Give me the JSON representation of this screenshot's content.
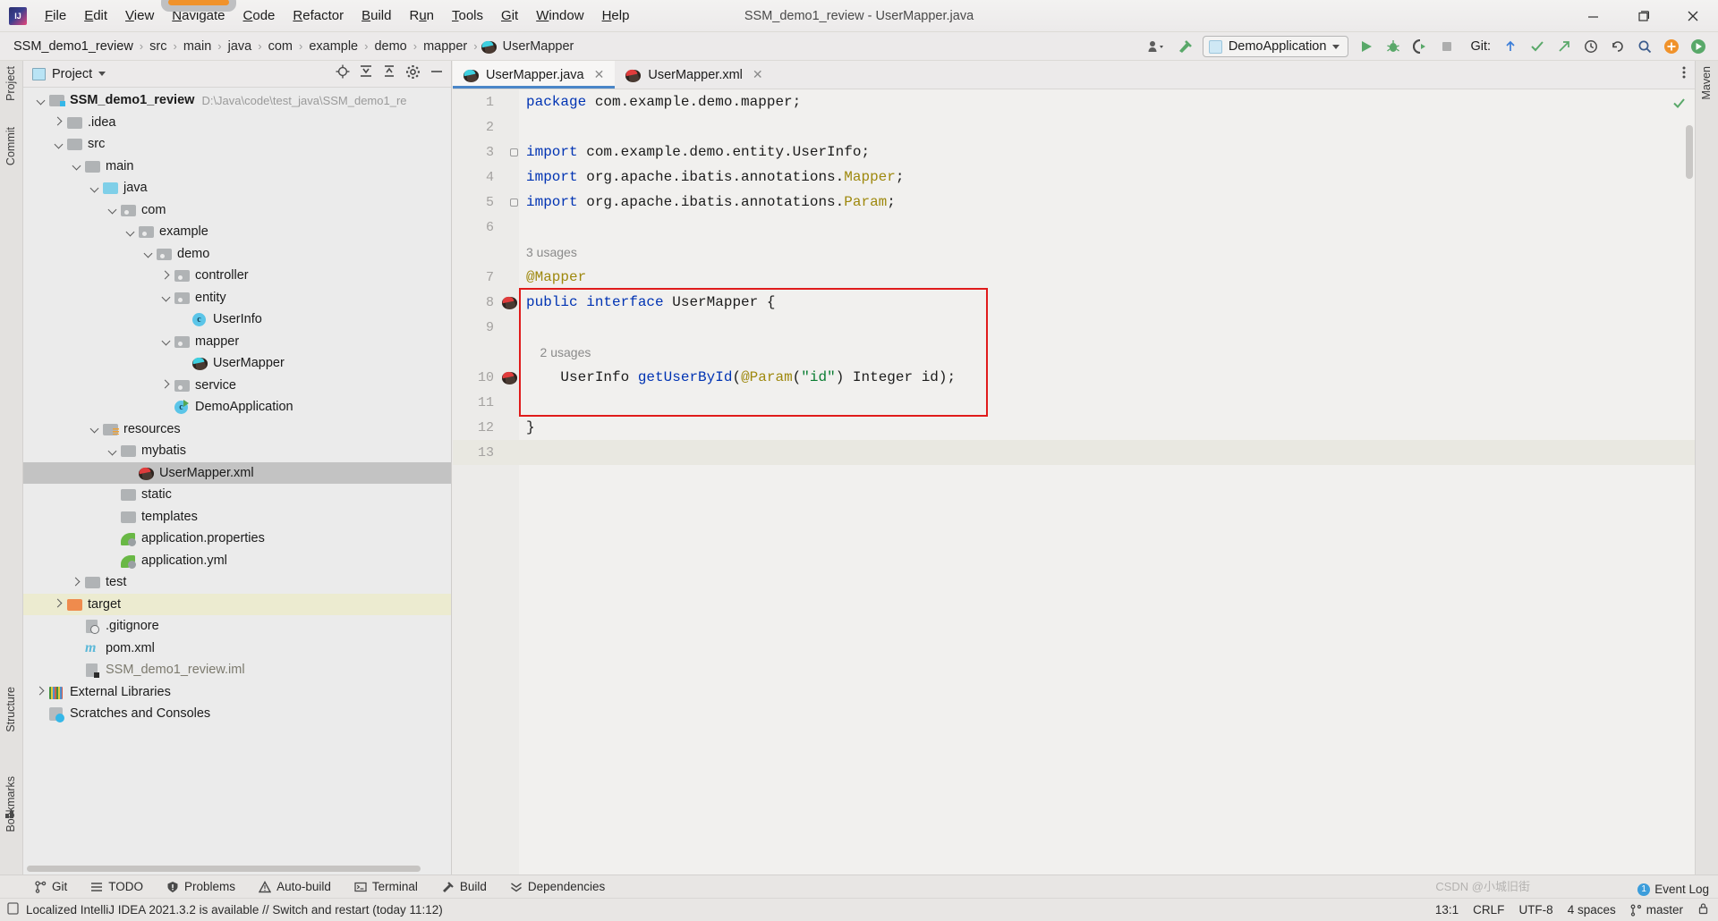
{
  "window": {
    "title": "SSM_demo1_review - UserMapper.java",
    "minimize": "—",
    "maximize": "▢",
    "close": "✕"
  },
  "menu": {
    "items": [
      {
        "label": "File",
        "mnemonic": "F"
      },
      {
        "label": "Edit",
        "mnemonic": "E"
      },
      {
        "label": "View",
        "mnemonic": "V"
      },
      {
        "label": "Navigate",
        "mnemonic": "N"
      },
      {
        "label": "Code",
        "mnemonic": "C"
      },
      {
        "label": "Refactor",
        "mnemonic": "R"
      },
      {
        "label": "Build",
        "mnemonic": "B"
      },
      {
        "label": "Run",
        "mnemonic": "u"
      },
      {
        "label": "Tools",
        "mnemonic": "T"
      },
      {
        "label": "Git",
        "mnemonic": "G"
      },
      {
        "label": "Window",
        "mnemonic": "W"
      },
      {
        "label": "Help",
        "mnemonic": "H"
      }
    ]
  },
  "breadcrumb": {
    "items": [
      "SSM_demo1_review",
      "src",
      "main",
      "java",
      "com",
      "example",
      "demo",
      "mapper",
      "UserMapper"
    ],
    "separator": "›"
  },
  "toolbar": {
    "run_config": "DemoApplication",
    "git_label": "Git:",
    "icons": [
      "user-dropdown-icon",
      "build-hammer-icon",
      "run-icon",
      "debug-icon",
      "run-coverage-icon",
      "stop-icon",
      "git-update-icon",
      "git-commit-icon",
      "git-push-icon",
      "history-icon",
      "undo-icon",
      "search-icon",
      "settings-plus-icon",
      "ide-icon"
    ]
  },
  "left_stripe": [
    "Project",
    "Commit",
    "Structure",
    "Bookmarks"
  ],
  "right_stripe": [
    "Maven"
  ],
  "project": {
    "title": "Project",
    "actions": [
      "locate-icon",
      "expand-all-icon",
      "collapse-all-icon",
      "settings-icon",
      "hide-icon"
    ],
    "tree": [
      {
        "label": "SSM_demo1_review",
        "detail": "D:\\Java\\code\\test_java\\SSM_demo1_re",
        "indent": 0,
        "arrow": "down",
        "icon": "module-folder",
        "bold": true
      },
      {
        "label": ".idea",
        "detail": "",
        "indent": 1,
        "arrow": "right",
        "icon": "folder"
      },
      {
        "label": "src",
        "detail": "",
        "indent": 1,
        "arrow": "down",
        "icon": "folder"
      },
      {
        "label": "main",
        "detail": "",
        "indent": 2,
        "arrow": "down",
        "icon": "folder"
      },
      {
        "label": "java",
        "detail": "",
        "indent": 3,
        "arrow": "down",
        "icon": "source-folder"
      },
      {
        "label": "com",
        "detail": "",
        "indent": 4,
        "arrow": "down",
        "icon": "package"
      },
      {
        "label": "example",
        "detail": "",
        "indent": 5,
        "arrow": "down",
        "icon": "package"
      },
      {
        "label": "demo",
        "detail": "",
        "indent": 6,
        "arrow": "down",
        "icon": "package"
      },
      {
        "label": "controller",
        "detail": "",
        "indent": 7,
        "arrow": "right",
        "icon": "package"
      },
      {
        "label": "entity",
        "detail": "",
        "indent": 7,
        "arrow": "down",
        "icon": "package"
      },
      {
        "label": "UserInfo",
        "detail": "",
        "indent": 8,
        "arrow": "none",
        "icon": "class"
      },
      {
        "label": "mapper",
        "detail": "",
        "indent": 7,
        "arrow": "down",
        "icon": "package"
      },
      {
        "label": "UserMapper",
        "detail": "",
        "indent": 8,
        "arrow": "none",
        "icon": "mybatis"
      },
      {
        "label": "service",
        "detail": "",
        "indent": 7,
        "arrow": "right",
        "icon": "package"
      },
      {
        "label": "DemoApplication",
        "detail": "",
        "indent": 7,
        "arrow": "none",
        "icon": "class-run"
      },
      {
        "label": "resources",
        "detail": "",
        "indent": 3,
        "arrow": "down",
        "icon": "resource-folder"
      },
      {
        "label": "mybatis",
        "detail": "",
        "indent": 4,
        "arrow": "down",
        "icon": "folder"
      },
      {
        "label": "UserMapper.xml",
        "detail": "",
        "indent": 5,
        "arrow": "none",
        "icon": "mybatis-xml",
        "selected": true
      },
      {
        "label": "static",
        "detail": "",
        "indent": 4,
        "arrow": "none",
        "icon": "folder"
      },
      {
        "label": "templates",
        "detail": "",
        "indent": 4,
        "arrow": "none",
        "icon": "folder"
      },
      {
        "label": "application.properties",
        "detail": "",
        "indent": 4,
        "arrow": "none",
        "icon": "spring-leaf"
      },
      {
        "label": "application.yml",
        "detail": "",
        "indent": 4,
        "arrow": "none",
        "icon": "spring-leaf"
      },
      {
        "label": "test",
        "detail": "",
        "indent": 2,
        "arrow": "right",
        "icon": "folder"
      },
      {
        "label": "target",
        "detail": "",
        "indent": 1,
        "arrow": "right",
        "icon": "excluded-folder",
        "highlight": true
      },
      {
        "label": ".gitignore",
        "detail": "",
        "indent": 2,
        "arrow": "none",
        "icon": "gitignore-file"
      },
      {
        "label": "pom.xml",
        "detail": "",
        "indent": 2,
        "arrow": "none",
        "icon": "maven-file"
      },
      {
        "label": "SSM_demo1_review.iml",
        "detail": "",
        "indent": 2,
        "arrow": "none",
        "icon": "iml-file",
        "muted": true
      },
      {
        "label": "External Libraries",
        "detail": "",
        "indent": 0,
        "arrow": "right",
        "icon": "library"
      },
      {
        "label": "Scratches and Consoles",
        "detail": "",
        "indent": 0,
        "arrow": "none",
        "icon": "scratch"
      }
    ]
  },
  "editor": {
    "tabs": [
      {
        "label": "UserMapper.java",
        "icon": "mybatis-java-icon",
        "active": true,
        "close": "✕"
      },
      {
        "label": "UserMapper.xml",
        "icon": "mybatis-xml-icon",
        "active": false,
        "close": "✕"
      }
    ],
    "lines": [
      {
        "num": "1",
        "gutter": "",
        "segments": [
          {
            "t": "package",
            "c": "kw"
          },
          {
            "t": " com.example.demo.mapper;",
            "c": "typ"
          }
        ]
      },
      {
        "num": "2",
        "gutter": "",
        "segments": []
      },
      {
        "num": "3",
        "gutter": "",
        "fold": true,
        "segments": [
          {
            "t": "import",
            "c": "kw"
          },
          {
            "t": " com.example.demo.entity.UserInfo;",
            "c": "typ"
          }
        ]
      },
      {
        "num": "4",
        "gutter": "",
        "segments": [
          {
            "t": "import",
            "c": "kw"
          },
          {
            "t": " org.apache.ibatis.annotations.",
            "c": "typ"
          },
          {
            "t": "Mapper",
            "c": "ann"
          },
          {
            "t": ";",
            "c": "typ"
          }
        ]
      },
      {
        "num": "5",
        "gutter": "",
        "fold": true,
        "segments": [
          {
            "t": "import",
            "c": "kw"
          },
          {
            "t": " org.apache.ibatis.annotations.",
            "c": "typ"
          },
          {
            "t": "Param",
            "c": "ann"
          },
          {
            "t": ";",
            "c": "typ"
          }
        ]
      },
      {
        "num": "6",
        "gutter": "",
        "segments": []
      },
      {
        "num": "",
        "gutter": "",
        "usage": "3 usages",
        "segments": []
      },
      {
        "num": "7",
        "gutter": "",
        "segments": [
          {
            "t": "@Mapper",
            "c": "ann"
          }
        ]
      },
      {
        "num": "8",
        "gutter": "mybatis-gutter-icon",
        "segments": [
          {
            "t": "public",
            "c": "kw"
          },
          {
            "t": " ",
            "c": "typ"
          },
          {
            "t": "interface",
            "c": "kw"
          },
          {
            "t": " UserMapper {",
            "c": "typ"
          }
        ]
      },
      {
        "num": "9",
        "gutter": "",
        "segments": []
      },
      {
        "num": "",
        "gutter": "",
        "usage": "    2 usages",
        "segments": []
      },
      {
        "num": "10",
        "gutter": "mybatis-gutter-icon",
        "segments": [
          {
            "t": "    UserInfo ",
            "c": "typ"
          },
          {
            "t": "getUserById",
            "c": "mth"
          },
          {
            "t": "(",
            "c": "typ"
          },
          {
            "t": "@Param",
            "c": "ann"
          },
          {
            "t": "(",
            "c": "typ"
          },
          {
            "t": "\"id\"",
            "c": "str"
          },
          {
            "t": ") Integer id);",
            "c": "typ"
          }
        ]
      },
      {
        "num": "11",
        "gutter": "",
        "segments": []
      },
      {
        "num": "12",
        "gutter": "",
        "segments": [
          {
            "t": "}",
            "c": "typ"
          }
        ]
      },
      {
        "num": "13",
        "gutter": "",
        "highlight": true,
        "segments": []
      }
    ]
  },
  "tool_windows": [
    {
      "label": "Git",
      "icon": "git-branch-icon"
    },
    {
      "label": "TODO",
      "icon": "todo-list-icon"
    },
    {
      "label": "Problems",
      "icon": "problems-icon"
    },
    {
      "label": "Auto-build",
      "icon": "auto-build-icon"
    },
    {
      "label": "Terminal",
      "icon": "terminal-icon"
    },
    {
      "label": "Build",
      "icon": "build-hammer-icon"
    },
    {
      "label": "Dependencies",
      "icon": "dependencies-icon"
    }
  ],
  "status": {
    "message": "Localized IntelliJ IDEA 2021.3.2 is available // Switch and restart (today 11:12)",
    "message_icon": "notification-icon",
    "caret": "13:1",
    "line_sep": "CRLF",
    "encoding": "UTF-8",
    "indent": "4 spaces",
    "branch": "master",
    "branch_icon": "git-branch-icon",
    "event_log": "Event Log",
    "event_count": "1",
    "lock_icon": "lock-icon"
  },
  "watermark": "CSDN @小城旧街",
  "colors": {
    "accent_blue": "#4a86c8",
    "keyword": "#0033b3",
    "annotation": "#9e880d",
    "string": "#0a7d32",
    "highlight_red": "#e01b1b",
    "selection_gray": "#c3c3c3",
    "target_yellow": "#ecebd0",
    "run_green": "#59a869"
  }
}
